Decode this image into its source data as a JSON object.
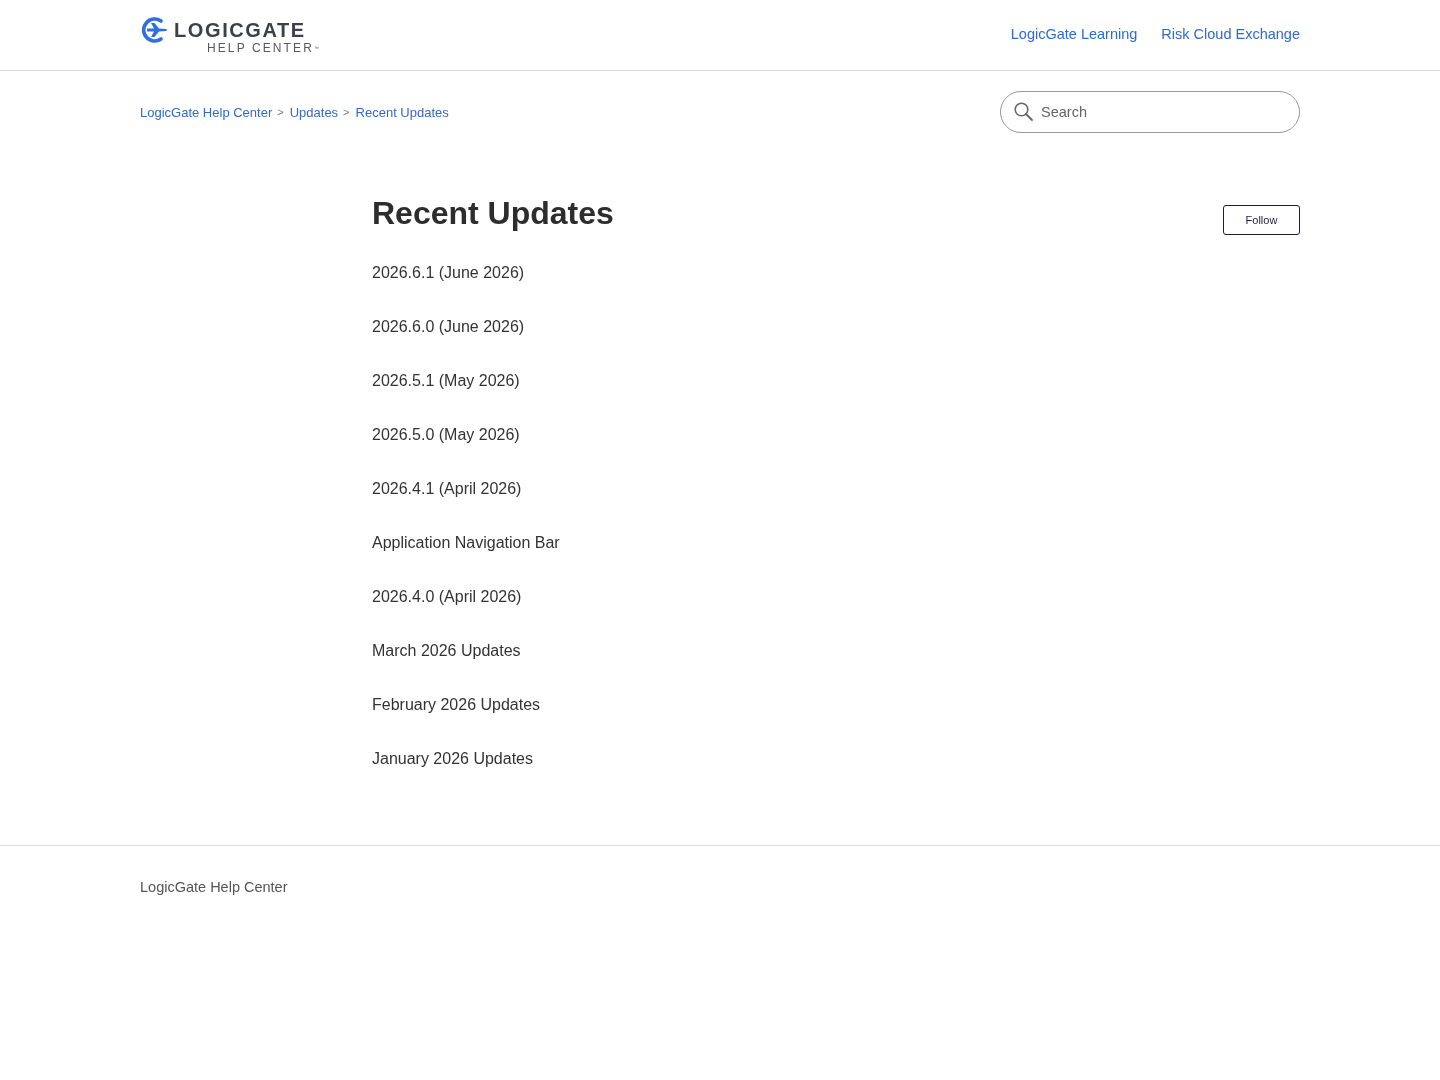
{
  "header": {
    "logo": {
      "wordmark": "LOGICGATE",
      "subtitle": "HELP CENTER$^{™}$"
    },
    "nav_links": [
      "LogicGate Learning",
      "Risk Cloud Exchange"
    ]
  },
  "breadcrumbs": [
    {
      "label": "LogicGate Help Center",
      "separator": ">"
    },
    {
      "label": "Updates",
      "separator": ">"
    },
    {
      "label": "Recent Updates"
    }
  ],
  "search": {
    "placeholder": "Search"
  },
  "section": {
    "title": "Recent Updates",
    "follow_button": "Follow",
    "articles": [
      "2026.6.1 (June 2026)",
      "2026.6.0 (June 2026)",
      "2026.5.1 (May 2026)",
      "2026.5.0 (May 2026)",
      "2026.4.1 (April 2026)",
      "Application Navigation Bar",
      "2026.4.0 (April 2026)",
      "March 2026 Updates",
      "February 2026 Updates",
      "January 2026 Updates"
    ]
  },
  "footer": {
    "text": "LogicGate Help Center"
  }
}
